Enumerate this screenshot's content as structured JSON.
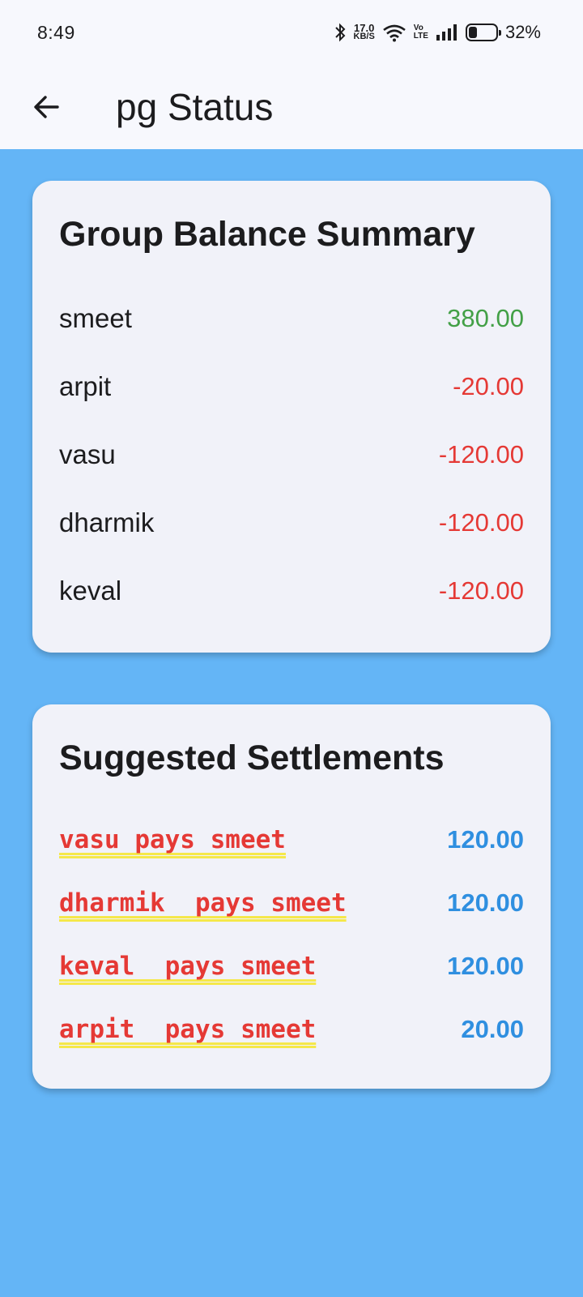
{
  "status_bar": {
    "time": "8:49",
    "net_speed_value": "17.0",
    "net_speed_unit": "KB/S",
    "volte_top": "Vo",
    "volte_bottom": "LTE",
    "battery": "32%",
    "battery_level": 0.32,
    "icons": [
      "bluetooth-icon",
      "wifi-icon",
      "signal-icon",
      "battery-icon"
    ]
  },
  "app_bar": {
    "back_icon": "arrow-back-icon",
    "title": "pg Status"
  },
  "balance_summary": {
    "title": "Group Balance Summary",
    "rows": [
      {
        "name": "smeet",
        "amount": "380.00",
        "color": "#43a047"
      },
      {
        "name": "arpit",
        "amount": "-20.00",
        "color": "#e53935"
      },
      {
        "name": "vasu",
        "amount": "-120.00",
        "color": "#e53935"
      },
      {
        "name": "dharmik",
        "amount": "-120.00",
        "color": "#e53935"
      },
      {
        "name": "keval",
        "amount": "-120.00",
        "color": "#e53935"
      }
    ]
  },
  "settlements": {
    "title": "Suggested Settlements",
    "rows": [
      {
        "text": "vasu pays smeet",
        "amount": "120.00"
      },
      {
        "text": "dharmik  pays smeet",
        "amount": "120.00"
      },
      {
        "text": "keval  pays smeet",
        "amount": "120.00"
      },
      {
        "text": "arpit  pays smeet",
        "amount": "20.00"
      }
    ]
  },
  "colors": {
    "background": "#64b5f6",
    "card": "#f1f2f9",
    "positive": "#43a047",
    "negative": "#e53935",
    "settle_amount": "#2f8fe0"
  }
}
